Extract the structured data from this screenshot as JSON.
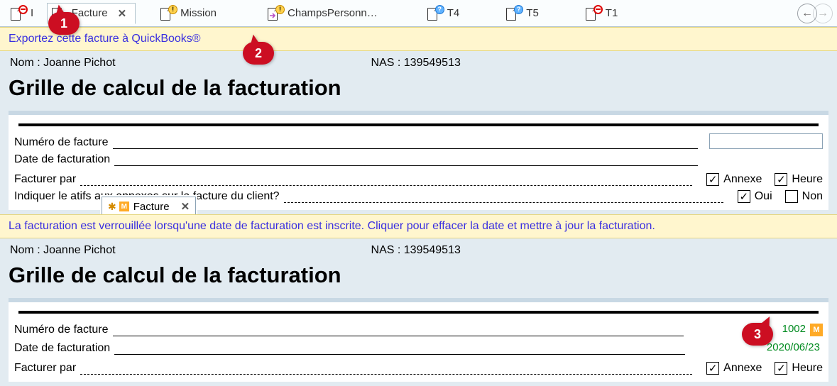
{
  "tabs": [
    {
      "ico": "deny",
      "label": "I"
    },
    {
      "ico": "arrow",
      "label": "Facture",
      "active": true,
      "closable": true
    },
    {
      "ico": "warn",
      "label": "Mission"
    },
    {
      "ico": "arrow-warn",
      "label": "ChampsPersonn…"
    },
    {
      "ico": "q",
      "label": "T4"
    },
    {
      "ico": "q",
      "label": "T5"
    },
    {
      "ico": "deny",
      "label": "T1"
    }
  ],
  "banner1": "Exportez cette facture à QuickBooks®",
  "banner2": "La facturation est verrouillée lorsqu'une date de facturation est inscrite. Cliquer pour effacer la date et mettre à jour la facturation.",
  "panels": {
    "nom_label": "Nom :",
    "nom": "Joanne Pichot",
    "nas_label": "NAS :",
    "nas": "139549513",
    "title": "Grille de calcul de la facturation",
    "row_numero": "Numéro de facture",
    "row_date": "Date de facturation",
    "row_facturer": "Facturer par",
    "row_indiquer": "Indiquer le                                             atifs aux annexes sur la facture du client?",
    "ck_annexe": "Annexe",
    "ck_heure": "Heure",
    "ck_oui": "Oui",
    "ck_non": "Non"
  },
  "floating_tab_label": "Facture",
  "panel2_values": {
    "numero": "1002",
    "date": "2020/06/23"
  },
  "callouts": {
    "c1": "1",
    "c2": "2",
    "c3": "3"
  }
}
